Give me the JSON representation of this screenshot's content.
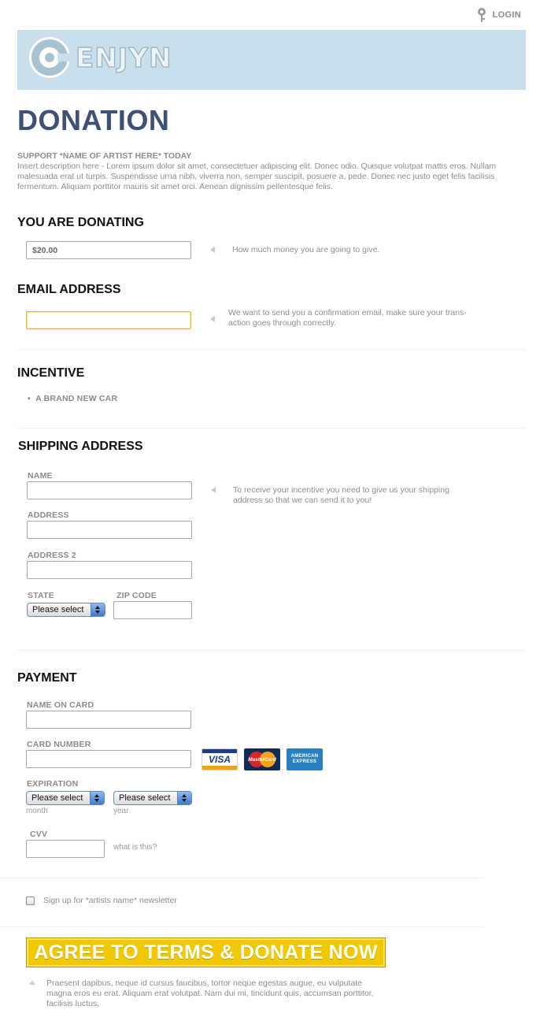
{
  "topbar": {
    "login_label": "LOGIN"
  },
  "header": {
    "logo_text": "ENJYN"
  },
  "page": {
    "title": "DONATION",
    "support_heading": "SUPPORT *NAME OF ARTIST HERE* TODAY",
    "description": "Insert description here - Lorem ipsum dolor sit amet, consectetuer adipiscing elit. Donec odio. Quisque volutpat mattis eros. Nullam malesuada erat ut turpis. Suspendisse urna nibh, viverra non, semper suscipit, posuere a, pede. Donec nec justo eget felis facilisis fermentum. Aliquam porttitor mauris sit amet orci. Aenean dignissim pellentesque felis."
  },
  "donating": {
    "heading": "YOU ARE DONATING",
    "amount_value": "$20.00",
    "hint": "How much money you are going to give."
  },
  "email": {
    "heading": "EMAIL ADDRESS",
    "value": "",
    "hint": "We want to send you a confirmation email, make sure your trans-action goes through correctly."
  },
  "incentive": {
    "heading": "INCENTIVE",
    "items": [
      "A BRAND NEW CAR"
    ]
  },
  "shipping": {
    "heading": "SHIPPING ADDRESS",
    "name_label": "NAME",
    "address_label": "ADDRESS",
    "address2_label": "ADDRESS 2",
    "state_label": "STATE",
    "state_value": "Please select",
    "zip_label": "ZIP CODE",
    "hint": "To receive your incentive you need to give us your shipping address so that we can send it to you!"
  },
  "payment": {
    "heading": "PAYMENT",
    "name_on_card_label": "NAME ON CARD",
    "card_number_label": "CARD NUMBER",
    "cards": {
      "visa": "VISA",
      "mastercard": "MasterCard",
      "amex_line1": "AMERICAN",
      "amex_line2": "EXPRESS"
    },
    "expiration_label": "EXPIRATION",
    "month_value": "Please select",
    "month_caption": "month",
    "year_value": "Please select",
    "year_caption": "year",
    "cvv_label": "CVV",
    "cvv_help": "what is this?"
  },
  "newsletter": {
    "label": "Sign up for *artists name* newsletter",
    "checked": false
  },
  "submit": {
    "button_label": "AGREE TO TERMS & DONATE NOW",
    "note": "Praesent dapibus, neque id cursus faucibus, tortor neque egestas augue, eu vulputate magna eros eu erat. Aliquam erat volutpat. Nam dui mi, tincidunt quis, accumsan porttitor, facilisis luctus,"
  },
  "colors": {
    "header_bg": "#c9dfeb",
    "title": "#3e5073",
    "button": "#f2c800"
  }
}
